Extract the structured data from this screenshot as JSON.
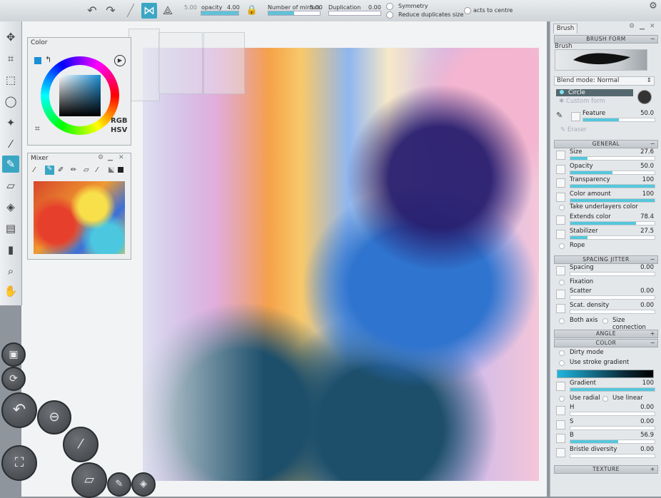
{
  "topbar": {
    "opacity_label": "opacity",
    "opacity_value": "4.00",
    "opacity_level": 1.0,
    "mirrors_label": "Number of mirrors",
    "mirrors_value": "5.00",
    "mirrors_level": 0.5,
    "duplication_label": "Duplication",
    "duplication_value": "0.00",
    "duplication_level": 0.0,
    "symmetry_label": "Symmetry",
    "reduce_label": "Reduce duplicates size",
    "centre_label": "acts to centre",
    "size_prefix": "5.00"
  },
  "color_panel": {
    "title": "Color",
    "rgb_label": "RGB",
    "hsv_label": "HSV",
    "current_color": "#1a8fd6"
  },
  "mixer_panel": {
    "title": "Mixer"
  },
  "brush_panel": {
    "tab_label": "Brush",
    "brush_form_header": "BRUSH FORM",
    "brush_label": "Brush",
    "blend_mode_label": "Blend mode:",
    "blend_mode_value": "Normal",
    "form_circle": "Circle",
    "form_custom": "Custom form",
    "feature_label": "Feature",
    "feature_value": "50.0",
    "feature_level": 0.5,
    "eraser_label": "Eraser",
    "general_header": "GENERAL",
    "general": [
      {
        "label": "Size",
        "value": "27.6",
        "level": 0.2
      },
      {
        "label": "Opacity",
        "value": "50.0",
        "level": 0.5
      },
      {
        "label": "Transparency",
        "value": "100",
        "level": 1.0
      },
      {
        "label": "Color amount",
        "value": "100",
        "level": 1.0
      }
    ],
    "take_underlayers": "Take underlayers color",
    "general2": [
      {
        "label": "Extends color",
        "value": "78.4",
        "level": 0.78
      },
      {
        "label": "Stabilizer",
        "value": "27.5",
        "level": 0.2
      }
    ],
    "rope_label": "Rope",
    "spacing_header": "SPACING JITTER",
    "spacing_value_label": "Spacing",
    "spacing_value": "0.00",
    "fixation_label": "Fixation",
    "spacing2": [
      {
        "label": "Scatter",
        "value": "0.00",
        "level": 0.0
      },
      {
        "label": "Scat. density",
        "value": "0.00",
        "level": 0.0
      }
    ],
    "both_axis": "Both axis",
    "size_connection": "Size connection",
    "angle_header": "ANGLE",
    "color_header": "COLOR",
    "dirty_mode": "Dirty mode",
    "use_stroke_gradient": "Use stroke gradient",
    "gradient_label": "Gradient",
    "gradient_value": "100",
    "gradient_level": 1.0,
    "use_radial": "Use radial",
    "use_linear": "Use linear",
    "hsb": [
      {
        "label": "H",
        "value": "0.00",
        "level": 0.0
      },
      {
        "label": "S",
        "value": "0.00",
        "level": 0.0
      },
      {
        "label": "B",
        "value": "56.9",
        "level": 0.57
      },
      {
        "label": "Bristle diversity",
        "value": "0.00",
        "level": 0.0
      }
    ],
    "texture_header": "TEXTURE"
  },
  "colors": {
    "accent": "#3aa6c4",
    "slider_fill": "#55c7dc"
  }
}
